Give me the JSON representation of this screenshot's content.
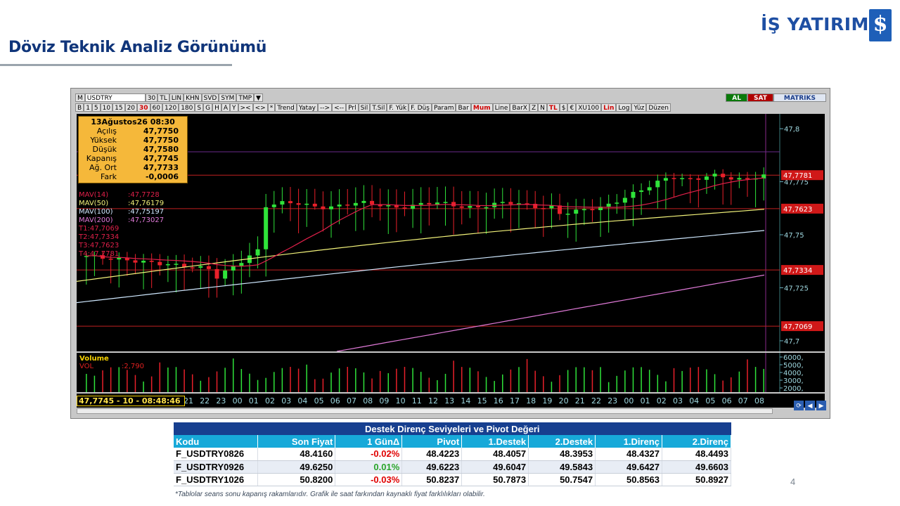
{
  "header": {
    "title": "Döviz Teknik Analiz Görünümü",
    "brand": "İŞ YATIRIM",
    "brand_logo_glyph": "$",
    "brand_color": "#1e4fa3"
  },
  "chart_window": {
    "toolbar_top": [
      "M",
      "USDTRY",
      "30",
      "TL",
      "LIN",
      "KHN",
      "SVD",
      "SYM",
      "TMP",
      "▼"
    ],
    "toolbar_top_right": [
      "AL",
      "SAT",
      "MATRIKS"
    ],
    "toolbar_bottom": [
      "B",
      "1",
      "5",
      "10",
      "15",
      "20",
      "30",
      "60",
      "120",
      "180",
      "S",
      "G",
      "H",
      "A",
      "Y",
      "><",
      "<>",
      "*",
      "Trend",
      "Yatay",
      "-->",
      "<--",
      "Prl",
      "Sil",
      "T.Sil",
      "F. Yük",
      "F. Düş",
      "Param",
      "Bar",
      "Mum",
      "Line",
      "BarX",
      "Z",
      "N",
      "TL",
      "$",
      "€",
      "XU100",
      "Lin",
      "Log",
      "Yüz",
      "Düzen"
    ],
    "toolbar_bottom_active": [
      "30",
      "Mum",
      "TL",
      "Lin"
    ],
    "info_box": {
      "date": "13Ağustos26 08:30",
      "rows": [
        {
          "label": "Açılış",
          "value": "47,7750"
        },
        {
          "label": "Yüksek",
          "value": "47,7750"
        },
        {
          "label": "Düşük",
          "value": "47,7580"
        },
        {
          "label": "Kapanış",
          "value": "47,7745"
        },
        {
          "label": "Ağ. Ort",
          "value": "47,7733"
        },
        {
          "label": "Fark",
          "value": "-0,0006"
        }
      ]
    },
    "indicators": [
      {
        "name": "MAV(14)",
        "value": ":47,7728",
        "color": "#e0204a"
      },
      {
        "name": "MAV(50)",
        "value": ":47,76179",
        "color": "#f2f27a"
      },
      {
        "name": "MAV(100)",
        "value": ":47,75197",
        "color": "#cfe8ff"
      },
      {
        "name": "MAV(200)",
        "value": ":47,73027",
        "color": "#e07ad8"
      },
      {
        "name": "T1:47,7069",
        "value": "",
        "color": "#e0204a"
      },
      {
        "name": "T2:47,7334",
        "value": "",
        "color": "#e0204a"
      },
      {
        "name": "T3:47,7623",
        "value": "",
        "color": "#e0204a"
      },
      {
        "name": "T4:47,7781",
        "value": "",
        "color": "#e0204a"
      }
    ],
    "volume_label": "Volume",
    "vol_label": "VOL",
    "vol_value": ":2,790",
    "price_readout": "47,7745 - 10 - 08:48:46",
    "price_axis_ticks": [
      "47,8",
      "47,775",
      "47,75",
      "47,725",
      "47,7"
    ],
    "price_axis_tags": [
      "47,7781",
      "47,7623",
      "47,7334",
      "47,7069"
    ],
    "volume_axis_ticks": [
      "6000,",
      "5000,",
      "4000,",
      "3000,",
      "2000,"
    ],
    "time_labels": [
      "21",
      "22",
      "23",
      "00",
      "01",
      "02",
      "03",
      "04",
      "05",
      "06",
      "07",
      "08",
      "09",
      "10",
      "11",
      "12",
      "13",
      "14",
      "15",
      "16",
      "17",
      "18",
      "19",
      "20",
      "21",
      "22",
      "23",
      "00",
      "01",
      "02",
      "03",
      "04",
      "05",
      "06",
      "07",
      "08"
    ]
  },
  "table": {
    "caption": "Destek Direnç Seviyeleri ve Pivot Değeri",
    "columns": [
      "Kodu",
      "Son Fiyat",
      "1 GünΔ",
      "Pivot",
      "1.Destek",
      "2.Destek",
      "1.Direnç",
      "2.Direnç"
    ],
    "rows": [
      [
        "F_USDTRY0826",
        "48.4160",
        "-0.02%",
        "48.4223",
        "48.4057",
        "48.3953",
        "48.4327",
        "48.4493"
      ],
      [
        "F_USDTRY0926",
        "49.6250",
        "0.01%",
        "49.6223",
        "49.6047",
        "49.5843",
        "49.6427",
        "49.6603"
      ],
      [
        "F_USDTRY1026",
        "50.8200",
        "-0.03%",
        "50.8237",
        "50.7873",
        "50.7547",
        "50.8563",
        "50.8927"
      ]
    ]
  },
  "footnote": "*Tablolar seans sonu kapanış rakamlarıdır. Grafik ile saat farkından kaynaklı fiyat farklılıkları olabilir.",
  "page_number": "4"
}
